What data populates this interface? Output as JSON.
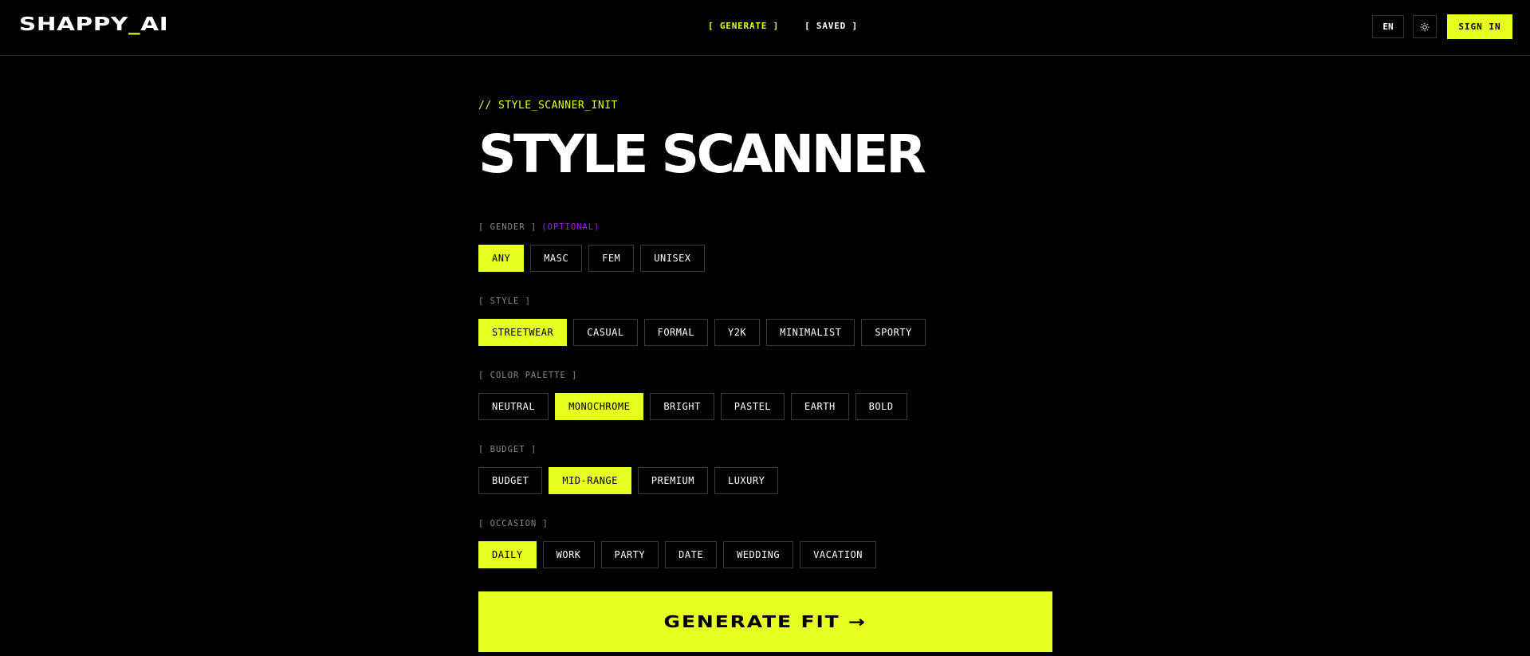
{
  "header": {
    "logo_main": "SHAPPY",
    "logo_under": "_",
    "logo_tail": "AI",
    "nav": [
      {
        "label": "[ GENERATE ]"
      },
      {
        "label": "[ SAVED ]"
      }
    ],
    "lang": "EN",
    "theme_icon": "sun-icon",
    "signin": "SIGN IN"
  },
  "main": {
    "init_label": "// STYLE_SCANNER_INIT",
    "title": "STYLE SCANNER",
    "sections": [
      {
        "label": "[ GENDER ]",
        "note": "(OPTIONAL)",
        "options": [
          "ANY",
          "MASC",
          "FEM",
          "UNISEX"
        ],
        "selected": "ANY"
      },
      {
        "label": "[ STYLE ]",
        "options": [
          "STREETWEAR",
          "CASUAL",
          "FORMAL",
          "Y2K",
          "MINIMALIST",
          "SPORTY"
        ],
        "selected": "STREETWEAR"
      },
      {
        "label": "[ COLOR PALETTE ]",
        "options": [
          "NEUTRAL",
          "MONOCHROME",
          "BRIGHT",
          "PASTEL",
          "EARTH",
          "BOLD"
        ],
        "selected": "MONOCHROME"
      },
      {
        "label": "[ BUDGET ]",
        "options": [
          "BUDGET",
          "MID-RANGE",
          "PREMIUM",
          "LUXURY"
        ],
        "selected": "MID-RANGE"
      },
      {
        "label": "[ OCCASION ]",
        "options": [
          "DAILY",
          "WORK",
          "PARTY",
          "DATE",
          "WEDDING",
          "VACATION"
        ],
        "selected": "DAILY"
      }
    ],
    "generate": "GENERATE FIT →"
  },
  "colors": {
    "accent": "#e6ff1f",
    "background": "#000000",
    "optional": "#a020f0"
  }
}
